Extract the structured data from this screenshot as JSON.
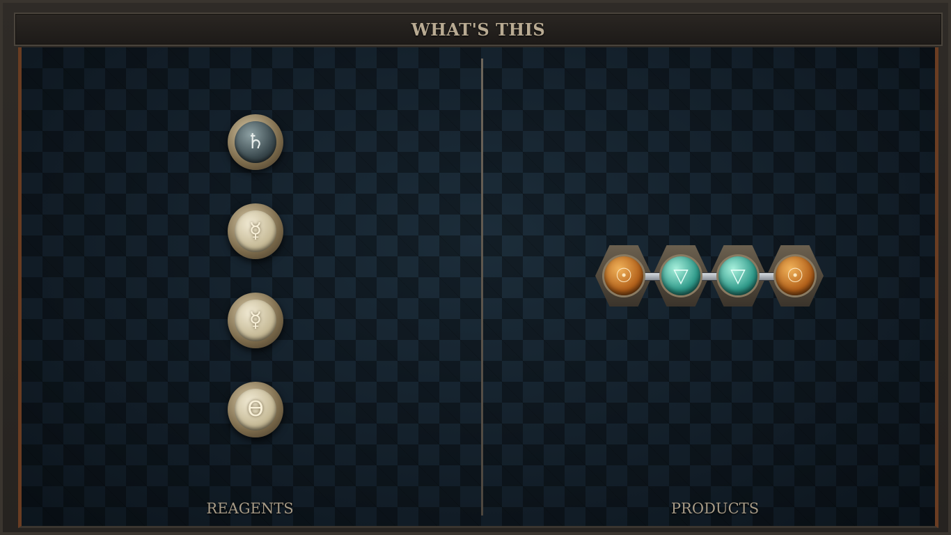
{
  "header": {
    "title": "WHAT'S THIS"
  },
  "reagents": {
    "label": "REAGENTS",
    "items": [
      {
        "symbol": "♄",
        "element": "salt",
        "tone": "dark"
      },
      {
        "symbol": "☿",
        "element": "quicksilver",
        "tone": "light"
      },
      {
        "symbol": "☿",
        "element": "quicksilver",
        "tone": "light"
      },
      {
        "symbol": "ϴ",
        "element": "salt",
        "tone": "light"
      }
    ]
  },
  "products": {
    "label": "PRODUCTS",
    "molecule": [
      {
        "symbol": "☉",
        "element": "gold"
      },
      {
        "symbol": "▽",
        "element": "water"
      },
      {
        "symbol": "▽",
        "element": "water"
      },
      {
        "symbol": "☉",
        "element": "gold"
      }
    ]
  },
  "colors": {
    "frame": "#2b2724",
    "board": "#13202b",
    "title_text": "#b9ab93",
    "label_text": "#a89c88",
    "accent_border": "#6a3d22"
  }
}
